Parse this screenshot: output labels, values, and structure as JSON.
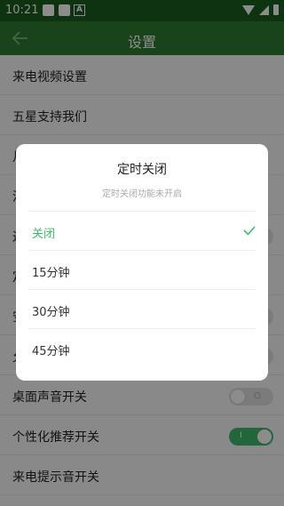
{
  "status_bar": {
    "time": "10:21",
    "a_label": "A"
  },
  "toolbar": {
    "title": "设置"
  },
  "settings": [
    {
      "label": "来电视频设置",
      "toggle": null
    },
    {
      "label": "五星支持我们",
      "toggle": null
    },
    {
      "label": "月",
      "toggle": null
    },
    {
      "label": "消",
      "toggle": null
    },
    {
      "label": "通",
      "toggle": "off"
    },
    {
      "label": "定",
      "toggle": null
    },
    {
      "label": "安",
      "toggle": "off"
    },
    {
      "label": "允",
      "toggle": "off"
    },
    {
      "label": "桌面声音开关",
      "toggle": "off",
      "toggle_mark": "○"
    },
    {
      "label": "个性化推荐开关",
      "toggle": "on",
      "toggle_mark": "I"
    },
    {
      "label": "来电提示音开关",
      "toggle": null
    }
  ],
  "dialog": {
    "title": "定时关闭",
    "subtitle": "定时关闭功能未开启",
    "options": [
      {
        "label": "关闭",
        "selected": true
      },
      {
        "label": "15分钟",
        "selected": false
      },
      {
        "label": "30分钟",
        "selected": false
      },
      {
        "label": "45分钟",
        "selected": false
      }
    ]
  },
  "colors": {
    "toolbar": "#2e7d32",
    "status_bar": "#1b5e20",
    "accent": "#3cbc6c"
  }
}
